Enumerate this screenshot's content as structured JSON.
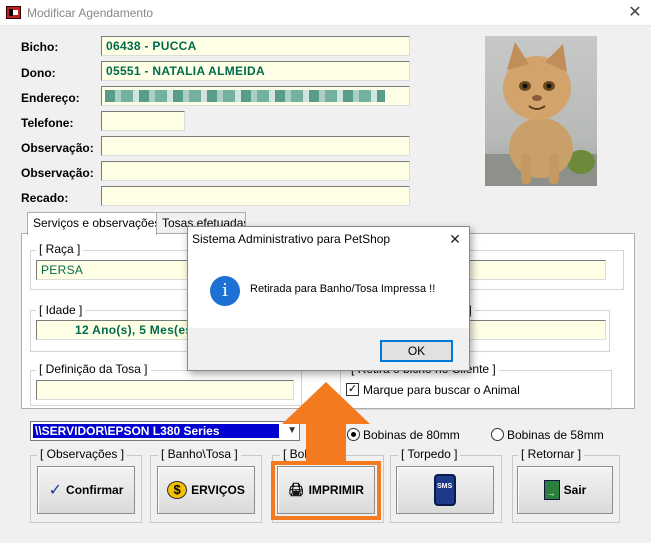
{
  "window": {
    "title": "Modificar Agendamento",
    "close_glyph": "✕"
  },
  "form": {
    "bicho_label": "Bicho:",
    "bicho_value": "06438 - PUCCA",
    "dono_label": "Dono:",
    "dono_value": "05551 - NATALIA ALMEIDA",
    "endereco_label": "Endereço:",
    "telefone_label": "Telefone:",
    "observacao1_label": "Observação:",
    "observacao2_label": "Observação:",
    "recado_label": "Recado:"
  },
  "tabs": [
    {
      "label": "Serviços e observações"
    },
    {
      "label": "Tosas efetuadas"
    }
  ],
  "panel": {
    "raca_title": "[ Raça ]",
    "raca_value": "PERSA",
    "idade_title": "[ Idade ]",
    "idade_value": "12 Ano(s), 5 Mes(es",
    "right_group_title": "to ]",
    "tosa_title": "[ Definição da Tosa ]",
    "retira_title": "[ Retira o bicho no Cliente ]",
    "retira_checkbox_label": "Marque para buscar o Animal",
    "retira_checked": true
  },
  "printer": {
    "selected": "\\\\SERVIDOR\\EPSON L380 Series"
  },
  "radios": [
    {
      "label": "Bobinas de 80mm",
      "selected": true
    },
    {
      "label": "Bobinas de 58mm",
      "selected": false
    }
  ],
  "button_groups": [
    {
      "title": "[ Observações ]",
      "button": "Confirmar",
      "icon": "check-icon"
    },
    {
      "title": "[ Banho\\Tosa ]",
      "button": "ERVIÇOS",
      "icon": "dollar-icon"
    },
    {
      "title": "[ Bole",
      "button": "IMPRIMIR",
      "icon": "printer-icon"
    },
    {
      "title": "[ Torpedo ]",
      "button": "",
      "icon": "sms-phone-icon",
      "icon_text": "SMS"
    },
    {
      "title": "[ Retornar ]",
      "button": "Sair",
      "icon": "exit-door-icon"
    }
  ],
  "dialog": {
    "title": "Sistema Administrativo para PetShop",
    "close_glyph": "✕",
    "message": "Retirada para Banho/Tosa Impressa !!",
    "ok_label": "OK",
    "icon": "info-icon",
    "icon_glyph": "i"
  },
  "colors": {
    "field_bg": "#ffffe5",
    "field_text": "#006b4e",
    "printer_highlight": "#0000d0",
    "overlay_orange": "#f47a20",
    "info_blue": "#1d71d5"
  }
}
